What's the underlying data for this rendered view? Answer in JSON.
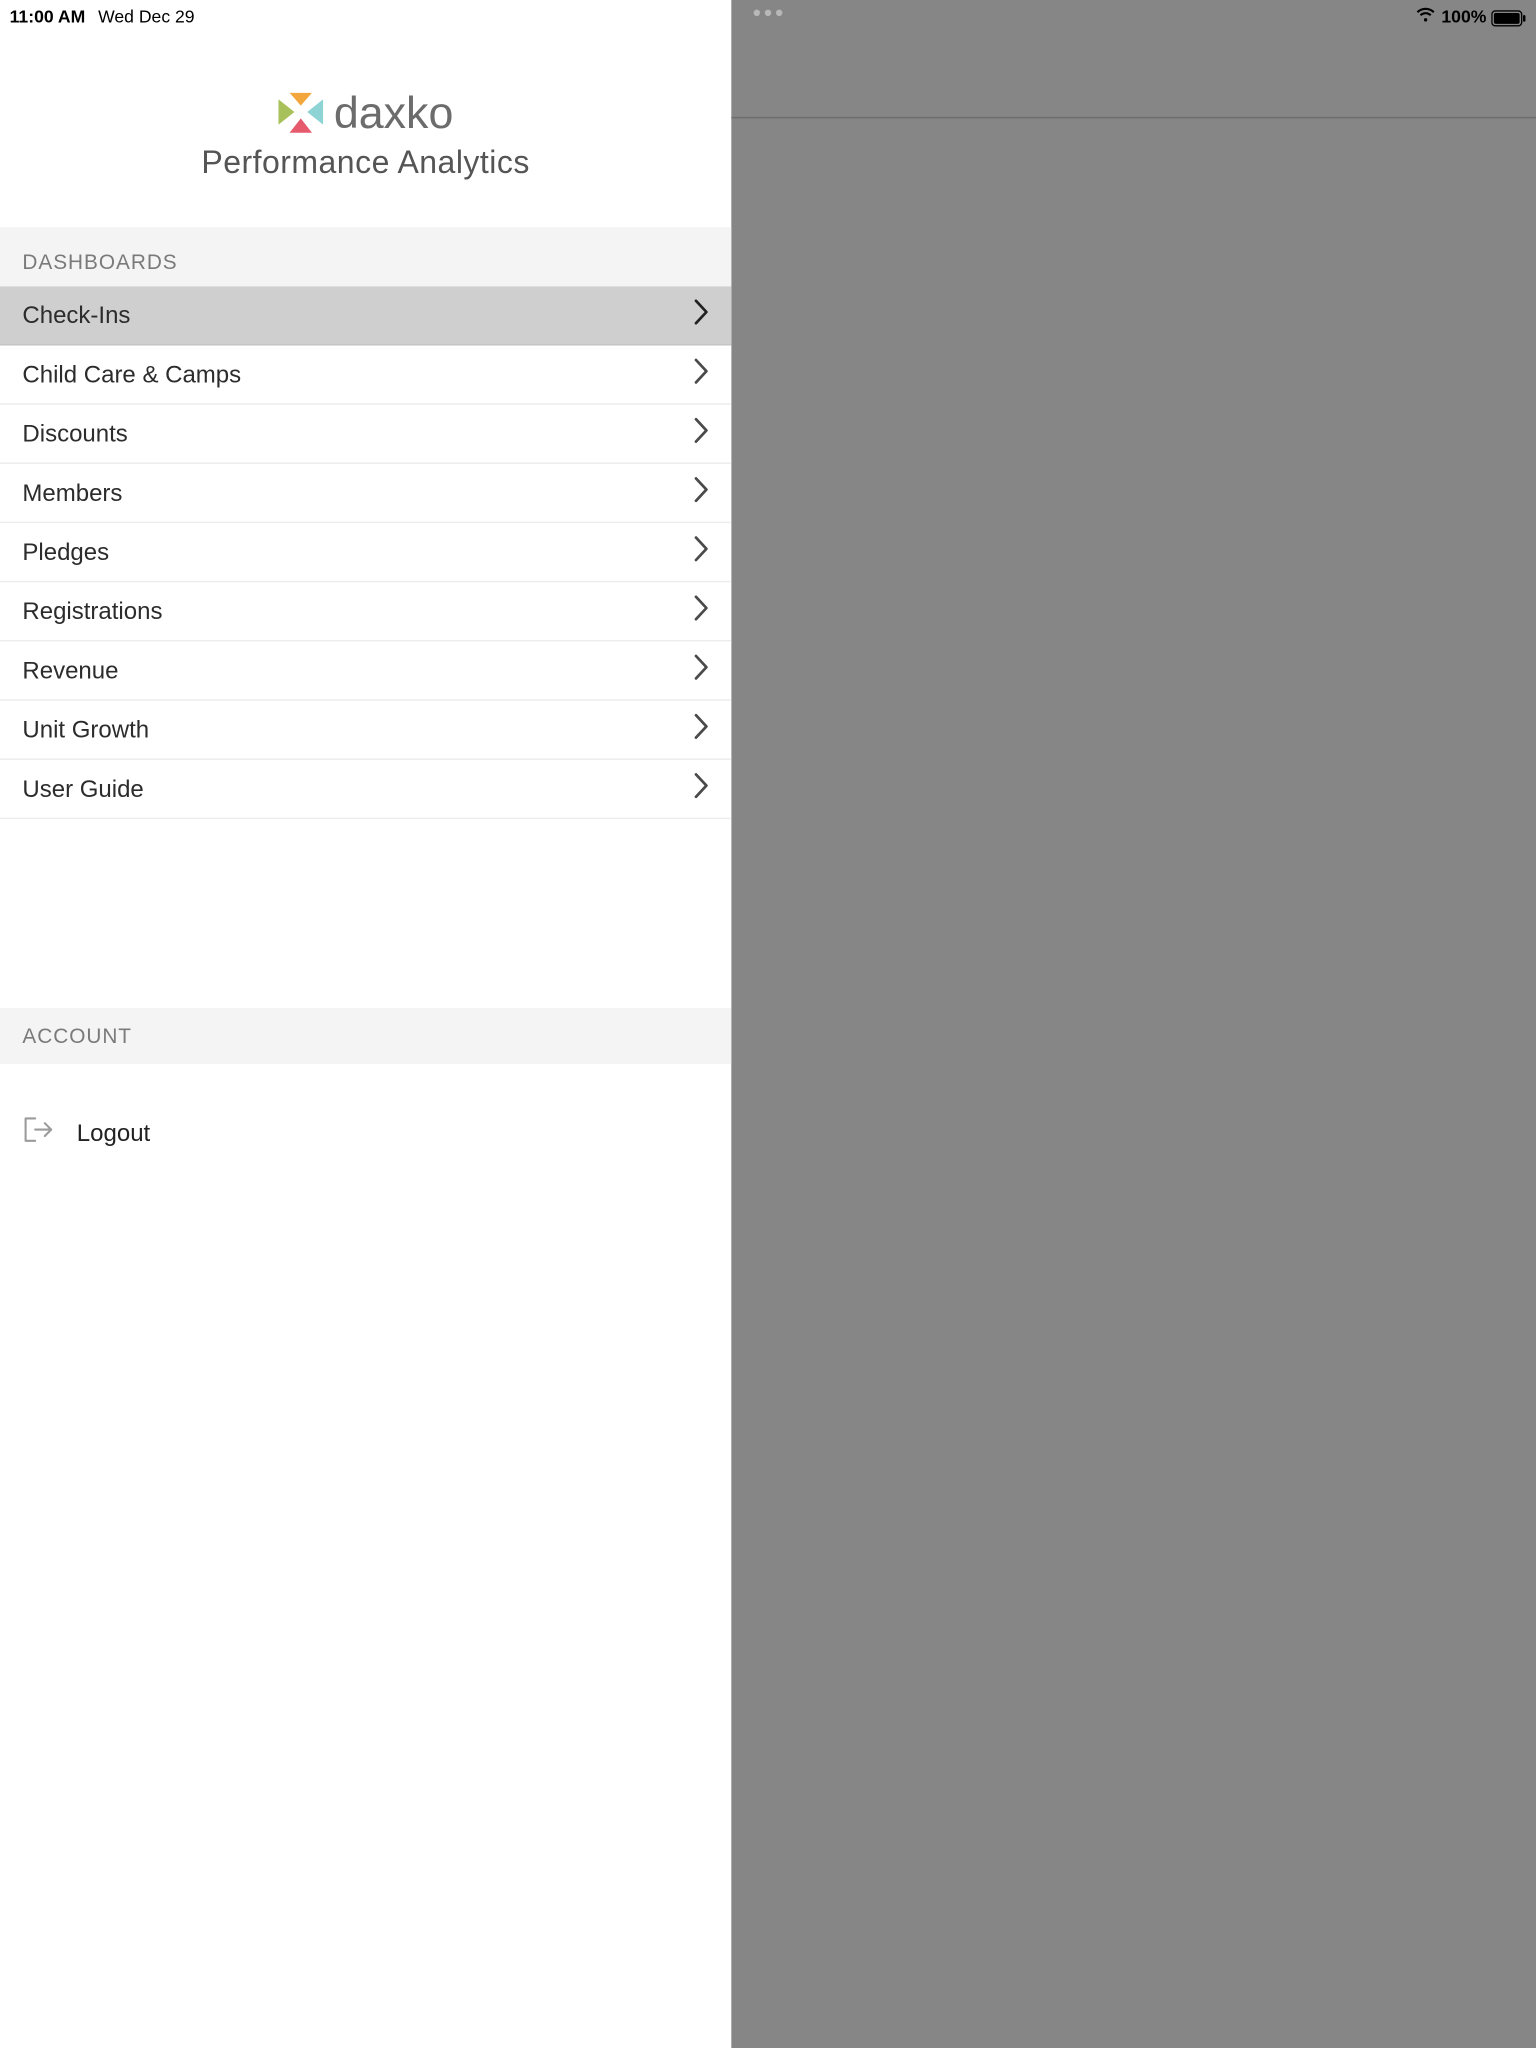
{
  "status": {
    "time": "11:00 AM",
    "date": "Wed Dec 29",
    "battery": "100%"
  },
  "brand": {
    "name": "daxko",
    "subtitle": "Performance Analytics"
  },
  "sections": {
    "dashboards": {
      "title": "DASHBOARDS",
      "items": [
        {
          "label": "Check-Ins",
          "selected": true
        },
        {
          "label": "Child Care & Camps"
        },
        {
          "label": "Discounts"
        },
        {
          "label": "Members"
        },
        {
          "label": "Pledges"
        },
        {
          "label": "Registrations"
        },
        {
          "label": "Revenue"
        },
        {
          "label": "Unit Growth"
        },
        {
          "label": "User Guide"
        }
      ]
    },
    "account": {
      "title": "ACCOUNT",
      "logout": "Logout"
    }
  }
}
